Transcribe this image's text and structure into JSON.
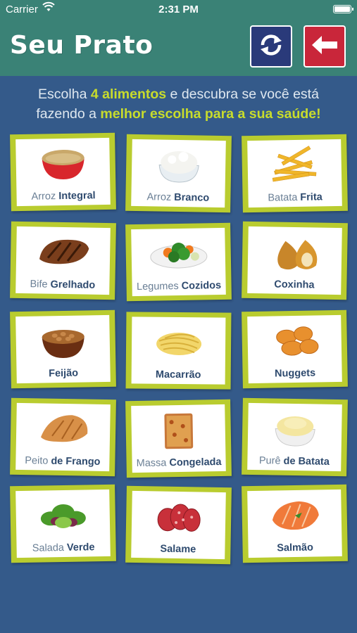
{
  "status": {
    "carrier": "Carrier",
    "time": "2:31 PM"
  },
  "header": {
    "title": "Seu Prato",
    "refresh_icon": "refresh-icon",
    "back_icon": "arrow-left-icon"
  },
  "instructions": {
    "l1a": "Escolha ",
    "l1b": "4 alimentos",
    "l1c": " e descubra se você está",
    "l2a": "fazendo a ",
    "l2b": "melhor escolha para a sua saúde!"
  },
  "foods": [
    {
      "light": "Arroz ",
      "bold": "Integral"
    },
    {
      "light": "Arroz ",
      "bold": "Branco"
    },
    {
      "light": "Batata ",
      "bold": "Frita"
    },
    {
      "light": "Bife ",
      "bold": "Grelhado"
    },
    {
      "light": "Legumes ",
      "bold": "Cozidos"
    },
    {
      "light": "",
      "bold": "Coxinha"
    },
    {
      "light": "",
      "bold": "Feijão"
    },
    {
      "light": "",
      "bold": "Macarrão"
    },
    {
      "light": "",
      "bold": "Nuggets"
    },
    {
      "light": "Peito ",
      "bold": "de Frango"
    },
    {
      "light": "Massa ",
      "bold": "Congelada"
    },
    {
      "light": "Purê ",
      "bold": "de Batata"
    },
    {
      "light": "Salada ",
      "bold": "Verde"
    },
    {
      "light": "",
      "bold": "Salame"
    },
    {
      "light": "",
      "bold": "Salmão"
    }
  ],
  "colors": {
    "background": "#345a8a",
    "header": "#3a8276",
    "card_border": "#b9cc2f",
    "highlight": "#c8dc2c",
    "back_button": "#c9263a",
    "refresh_button": "#2a3a7a"
  }
}
